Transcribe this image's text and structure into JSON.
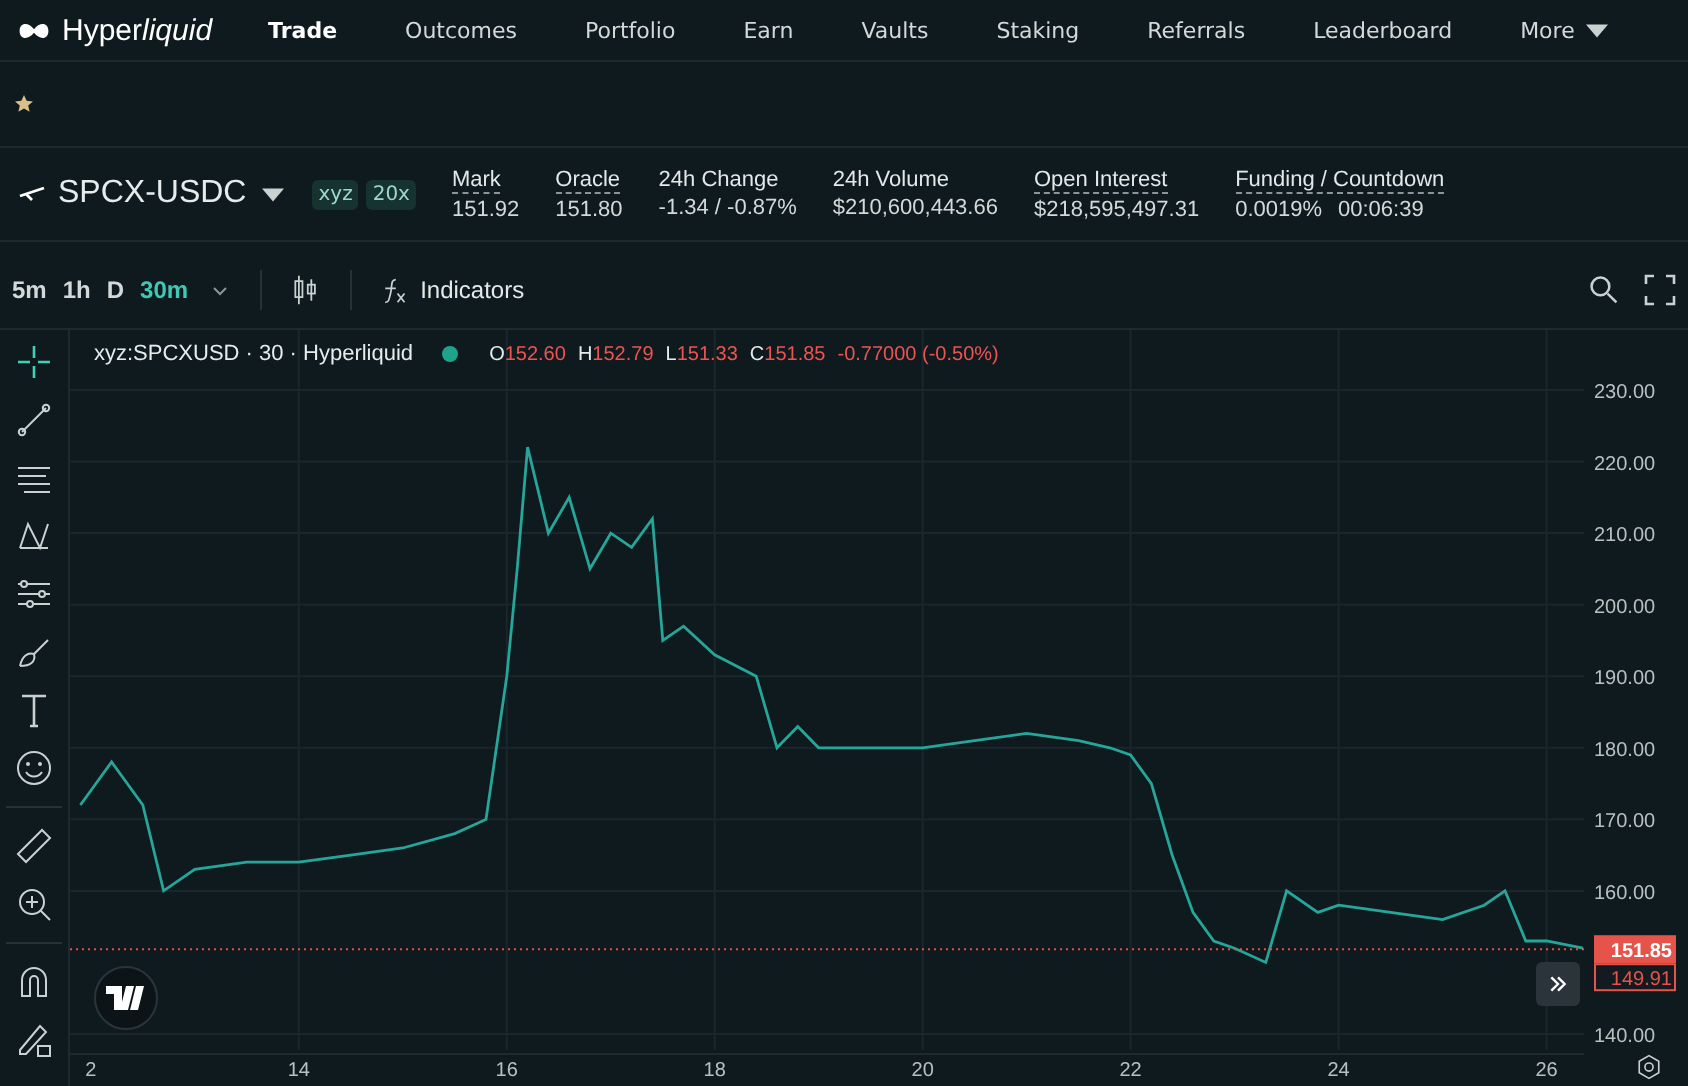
{
  "nav": {
    "logo": {
      "text": "Hyper",
      "italic": "liquid"
    },
    "items": [
      {
        "label": "Trade",
        "selected": true
      },
      {
        "label": "Outcomes",
        "selected": false
      },
      {
        "label": "Portfolio",
        "selected": false
      },
      {
        "label": "Earn",
        "selected": false
      },
      {
        "label": "Vaults",
        "selected": false
      },
      {
        "label": "Staking",
        "selected": false
      },
      {
        "label": "Referrals",
        "selected": false
      },
      {
        "label": "Leaderboard",
        "selected": false
      },
      {
        "label": "More",
        "selected": false
      }
    ]
  },
  "market": {
    "symbol": "SPCX-USDC",
    "tags": [
      "xyz",
      "20x"
    ],
    "stats": [
      {
        "label": "Mark",
        "values": [
          "151.92"
        ]
      },
      {
        "label": "Oracle",
        "values": [
          "151.80"
        ]
      },
      {
        "label": "24h Change",
        "values": [
          "-1.34 / -0.87%"
        ]
      },
      {
        "label": "24h Volume",
        "values": [
          "$210,600,443.66"
        ]
      },
      {
        "label": "Open Interest",
        "values": [
          "$218,595,497.31"
        ]
      },
      {
        "label": "Funding / Countdown",
        "values": [
          "0.0019%",
          "00:06:39"
        ]
      }
    ]
  },
  "toolbar": {
    "intervals": [
      {
        "label": "5m",
        "selected": false
      },
      {
        "label": "1h",
        "selected": false
      },
      {
        "label": "D",
        "selected": false
      },
      {
        "label": "30m",
        "selected": true
      }
    ],
    "indicators": "Indicators"
  },
  "legend": {
    "title": "xyz:SPCXUSD · 30 · Hyperliquid",
    "ohlc": [
      {
        "key": "O",
        "value": "152.60"
      },
      {
        "key": "H",
        "value": "152.79"
      },
      {
        "key": "L",
        "value": "151.33"
      },
      {
        "key": "C",
        "value": "151.85"
      }
    ],
    "change": "-0.77000 (-0.50%)"
  },
  "price_tags": {
    "other": "149.91"
  },
  "chart_data": {
    "type": "line",
    "x": [
      11.9,
      12.2,
      12.5,
      12.7,
      13,
      13.5,
      14,
      14.5,
      15,
      15.5,
      15.8,
      16,
      16.1,
      16.2,
      16.4,
      16.6,
      16.8,
      17,
      17.2,
      17.4,
      17.5,
      17.7,
      18,
      18.4,
      18.6,
      18.8,
      19,
      19.5,
      20,
      20.5,
      21,
      21.5,
      21.8,
      22,
      22.2,
      22.4,
      22.6,
      22.8,
      23,
      23.3,
      23.5,
      23.8,
      24,
      24.5,
      25,
      25.4,
      25.6,
      25.8,
      26,
      26.35
    ],
    "series": [
      {
        "color": "#26a69a",
        "values": [
          172,
          178,
          172,
          160,
          163,
          164,
          164,
          165,
          166,
          168,
          170,
          190,
          205,
          222,
          210,
          215,
          205,
          210,
          208,
          212,
          195,
          197,
          193,
          190,
          180,
          183,
          180,
          180,
          180,
          181,
          182,
          181,
          180,
          179,
          175,
          165,
          157,
          153,
          152,
          150,
          160,
          157,
          158,
          157,
          156,
          158,
          160,
          153,
          153,
          152
        ]
      }
    ],
    "grid": true,
    "ref_lines": [
      {
        "axis": "y",
        "value": 151.85,
        "color": "#e74c4c",
        "label": "151.85"
      }
    ],
    "xlim": [
      11.8,
      26.36
    ],
    "ylim": [
      140,
      230
    ],
    "yticks": [
      {
        "value": 140,
        "label": "140.00"
      },
      {
        "value": 160,
        "label": "160.00"
      },
      {
        "value": 170,
        "label": "170.00"
      },
      {
        "value": 180,
        "label": "180.00"
      },
      {
        "value": 190,
        "label": "190.00"
      },
      {
        "value": 200,
        "label": "200.00"
      },
      {
        "value": 210,
        "label": "210.00"
      },
      {
        "value": 220,
        "label": "220.00"
      },
      {
        "value": 230,
        "label": "230.00"
      }
    ],
    "xticks": [
      {
        "value": 14,
        "label": "14"
      },
      {
        "value": 16,
        "label": "16"
      },
      {
        "value": 18,
        "label": "18"
      },
      {
        "value": 20,
        "label": "20"
      },
      {
        "value": 22,
        "label": "22"
      },
      {
        "value": 24,
        "label": "24"
      },
      {
        "value": 26,
        "label": "26"
      }
    ]
  },
  "axis_edge_label": "2"
}
